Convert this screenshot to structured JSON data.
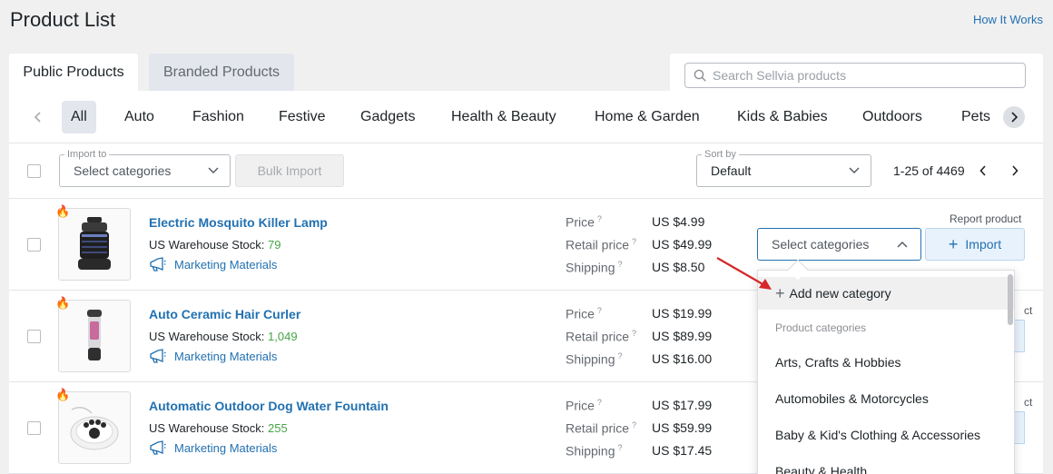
{
  "header": {
    "title": "Product List",
    "help_link": "How It Works"
  },
  "tabs": [
    {
      "label": "Public Products",
      "active": true
    },
    {
      "label": "Branded Products",
      "active": false
    }
  ],
  "search": {
    "placeholder": "Search Sellvia products"
  },
  "categories": [
    "All",
    "Auto",
    "Fashion",
    "Festive",
    "Gadgets",
    "Health & Beauty",
    "Home & Garden",
    "Kids & Babies",
    "Outdoors",
    "Pets"
  ],
  "toolbar": {
    "import_to_label": "Import to",
    "import_to_placeholder": "Select categories",
    "bulk_import_label": "Bulk Import",
    "sort_by_label": "Sort by",
    "sort_value": "Default",
    "pagination": "1-25 of 4469"
  },
  "labels": {
    "stock_prefix": "US Warehouse Stock: ",
    "marketing": "Marketing Materials",
    "price": "Price",
    "retail_price": "Retail price",
    "shipping": "Shipping",
    "help_mark": "?",
    "report": "Report product",
    "import": "Import",
    "select_categories": "Select categories",
    "report_partial": "ct"
  },
  "products": [
    {
      "name": "Electric Mosquito Killer Lamp",
      "stock": "79",
      "price": "US $4.99",
      "retail": "US $49.99",
      "shipping": "US $8.50"
    },
    {
      "name": "Auto Ceramic Hair Curler",
      "stock": "1,049",
      "price": "US $19.99",
      "retail": "US $89.99",
      "shipping": "US $16.00"
    },
    {
      "name": "Automatic Outdoor Dog Water Fountain",
      "stock": "255",
      "price": "US $17.99",
      "retail": "US $59.99",
      "shipping": "US $17.45"
    }
  ],
  "dropdown": {
    "add_label": "Add new category",
    "header": "Product categories",
    "items": [
      "Arts, Crafts & Hobbies",
      "Automobiles & Motorcycles",
      "Baby & Kid's Clothing & Accessories",
      "Beauty & Health"
    ]
  },
  "colors": {
    "link": "#2271b1",
    "stock_green": "#46a546",
    "arrow_red": "#d62828",
    "page_bg": "#f0f0f1"
  }
}
